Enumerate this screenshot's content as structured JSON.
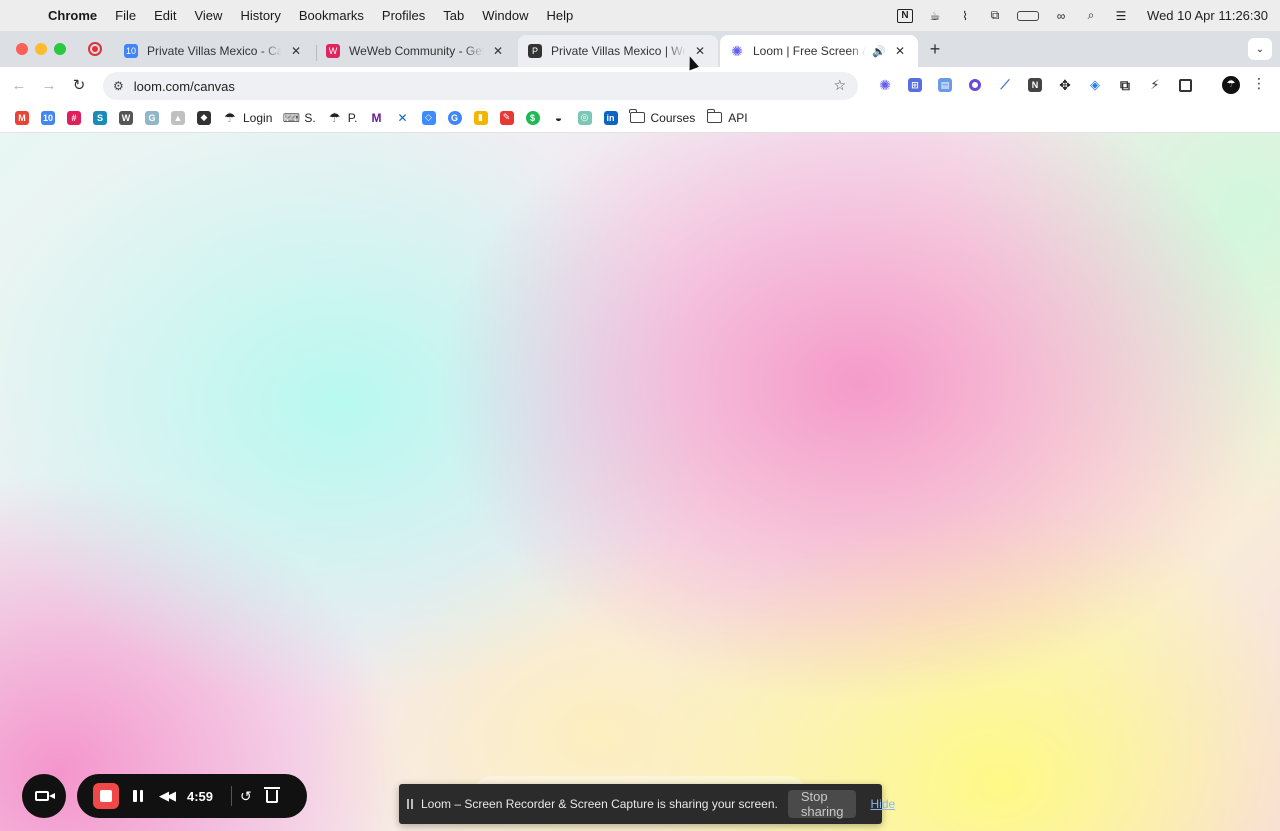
{
  "menubar": {
    "app": "Chrome",
    "items": [
      "File",
      "Edit",
      "View",
      "History",
      "Bookmarks",
      "Profiles",
      "Tab",
      "Window",
      "Help"
    ],
    "clock": "Wed 10 Apr  11:26:30"
  },
  "tabs": [
    {
      "title": "Private Villas Mexico - Calendar",
      "favicon_color": "#4285f4",
      "favicon_text": "10"
    },
    {
      "title": "WeWeb Community - Get help",
      "favicon_color": "#e0245e",
      "favicon_text": "W"
    },
    {
      "title": "Private Villas Mexico | WeWeb",
      "favicon_color": "#333333",
      "favicon_text": "P"
    },
    {
      "title": "Loom | Free Screen & Video",
      "favicon_color": "#625df5",
      "favicon_text": "✺"
    }
  ],
  "toolbar": {
    "url": "loom.com/canvas"
  },
  "bookmarks": [
    {
      "label": "",
      "color": "#ea4335",
      "text": "M"
    },
    {
      "label": "",
      "color": "#4285f4",
      "text": "10"
    },
    {
      "label": "",
      "color": "#e01e5a",
      "text": "#"
    },
    {
      "label": "",
      "color": "#1a8bb8",
      "text": "S"
    },
    {
      "label": "",
      "color": "#555555",
      "text": "W"
    },
    {
      "label": "",
      "color": "#8fb7c8",
      "text": "G"
    },
    {
      "label": "",
      "color": "#c0c0c0",
      "text": "▲"
    },
    {
      "label": "",
      "color": "#333333",
      "text": "◆"
    },
    {
      "label": "Login",
      "color": "#222222",
      "text": "☂"
    },
    {
      "label": "S.",
      "color": "#555555",
      "text": "⌨"
    },
    {
      "label": "P.",
      "color": "#222222",
      "text": "☂"
    },
    {
      "label": "",
      "color": "#6a1b9a",
      "text": "M"
    },
    {
      "label": "",
      "color": "#0a66c2",
      "text": "✕"
    },
    {
      "label": "",
      "color": "#3d8bfd",
      "text": "◇"
    },
    {
      "label": "",
      "color": "#4285f4",
      "text": "G"
    },
    {
      "label": "",
      "color": "#f4b400",
      "text": "▮"
    },
    {
      "label": "",
      "color": "#e53935",
      "text": "✎"
    },
    {
      "label": "",
      "color": "#1db954",
      "text": "$"
    },
    {
      "label": "",
      "color": "#222222",
      "text": "◒"
    },
    {
      "label": "",
      "color": "#7cc6b5",
      "text": "◎"
    },
    {
      "label": "",
      "color": "#0a66c2",
      "text": "in"
    },
    {
      "label": "Courses",
      "folder": true
    },
    {
      "label": "API",
      "folder": true
    }
  ],
  "loom": {
    "time": "4:59",
    "banner_text": "Loom – Screen Recorder & Screen Capture is sharing your screen.",
    "stop_label": "Stop sharing",
    "hide_label": "Hide"
  }
}
